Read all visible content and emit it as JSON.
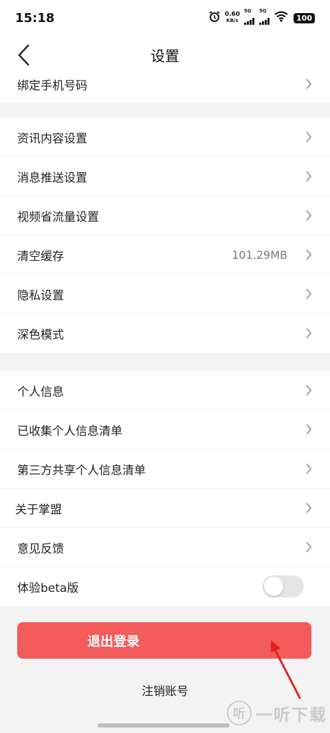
{
  "status_bar": {
    "time": "15:18",
    "net_speed_value": "0.60",
    "net_speed_unit": "KB/s",
    "signal1_label": "5G",
    "signal2_label": "5G",
    "battery": "100",
    "icons": [
      "alarm-icon",
      "signal-icon",
      "signal-icon",
      "wifi-icon",
      "battery-icon"
    ]
  },
  "nav": {
    "title": "设置",
    "back_icon": "chevron-left-icon"
  },
  "section1": {
    "items": [
      {
        "label": "绑定手机号码"
      }
    ]
  },
  "section2": {
    "items": [
      {
        "label": "资讯内容设置"
      },
      {
        "label": "消息推送设置"
      },
      {
        "label": "视频省流量设置"
      },
      {
        "label": "清空缓存",
        "value": "101.29MB"
      },
      {
        "label": "隐私设置"
      },
      {
        "label": "深色模式"
      }
    ]
  },
  "section3": {
    "items": [
      {
        "label": "个人信息"
      },
      {
        "label": "已收集个人信息清单"
      },
      {
        "label": "第三方共享个人信息清单"
      },
      {
        "label": "关于掌盟"
      },
      {
        "label": "意见反馈"
      },
      {
        "label": "体验beta版",
        "toggle_on": false
      }
    ]
  },
  "actions": {
    "logout_label": "退出登录",
    "cancel_account_label": "注销账号"
  },
  "colors": {
    "accent_red": "#f35a5a",
    "annotation_red": "#e02020"
  },
  "watermark": {
    "logo_text": "听",
    "text": "一听下载"
  }
}
